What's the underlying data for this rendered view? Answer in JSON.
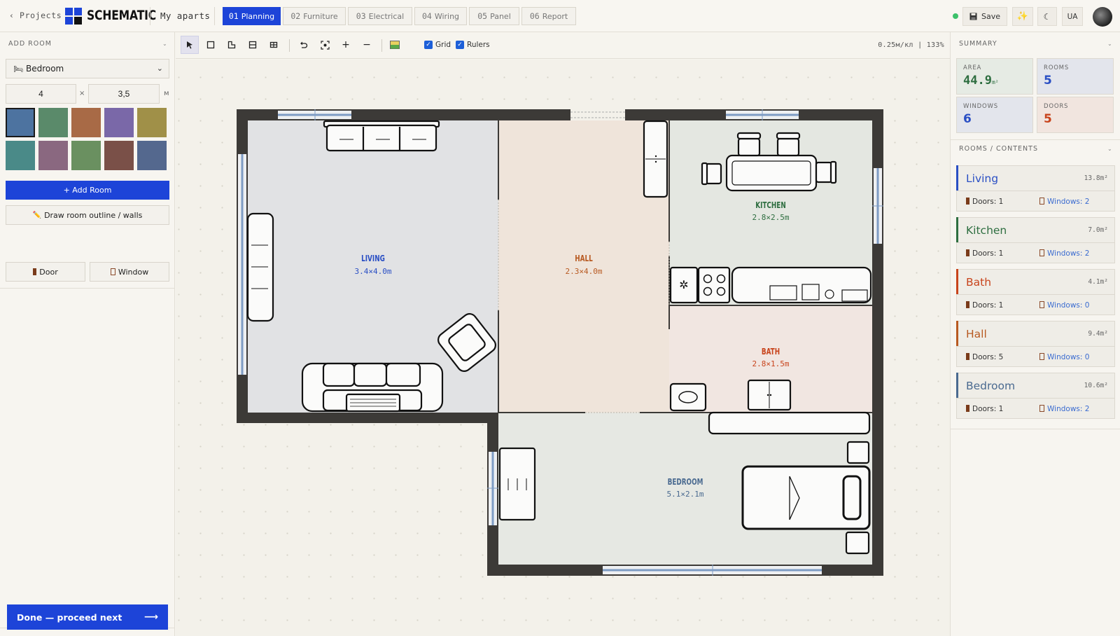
{
  "topbar": {
    "back_label": "‹ Projects",
    "app_name": "SCHEMATIC",
    "project_name": "My aparts",
    "tabs": [
      {
        "num": "01",
        "label": "Planning",
        "active": true
      },
      {
        "num": "02",
        "label": "Furniture",
        "active": false
      },
      {
        "num": "03",
        "label": "Electrical",
        "active": false
      },
      {
        "num": "04",
        "label": "Wiring",
        "active": false
      },
      {
        "num": "05",
        "label": "Panel",
        "active": false
      },
      {
        "num": "06",
        "label": "Report",
        "active": false
      }
    ],
    "save_label": "Save",
    "lang_label": "UA",
    "status_color": "#3cc16a"
  },
  "left": {
    "add_room_title": "ADD ROOM",
    "room_type": "Bedroom",
    "width_value": "4",
    "times_label": "×",
    "height_value": "3,5",
    "unit_label": "м",
    "swatches": [
      "#4d73a0",
      "#5a8a6a",
      "#a86a46",
      "#7a68a8",
      "#a09048",
      "#4a8a88",
      "#8a6880",
      "#6a9060",
      "#7a5048",
      "#54688e"
    ],
    "add_room_label": "+ Add Room",
    "draw_outline_label": "Draw room outline / walls",
    "door_label": "Door",
    "window_label": "Window",
    "done_label": "Done — proceed next",
    "done_arrow": "⟶"
  },
  "toolbar": {
    "grid_label": "Grid",
    "rulers_label": "Rulers",
    "grid_checked": true,
    "rulers_checked": true,
    "scale_readout": "0.25м/кл  |  133%"
  },
  "plan": {
    "rooms": [
      {
        "name": "LIVING",
        "dims": "3.4×4.0m",
        "color": "#2a4fc4"
      },
      {
        "name": "HALL",
        "dims": "2.3×4.0m",
        "color": "#b85a22"
      },
      {
        "name": "KITCHEN",
        "dims": "2.8×2.5m",
        "color": "#2e6e40"
      },
      {
        "name": "BATH",
        "dims": "2.8×1.5m",
        "color": "#c8441c"
      },
      {
        "name": "BEDROOM",
        "dims": "5.1×2.1m",
        "color": "#4a6a90"
      }
    ]
  },
  "summary": {
    "title": "SUMMARY",
    "area_label": "AREA",
    "area_value": "44.9",
    "area_unit": "m²",
    "rooms_label": "ROOMS",
    "rooms_value": "5",
    "windows_label": "WINDOWS",
    "windows_value": "6",
    "doors_label": "DOORS",
    "doors_value": "5"
  },
  "rooms_list": {
    "title": "ROOMS / CONTENTS",
    "items": [
      {
        "name": "Living",
        "area": "13.8m²",
        "doors": "Doors: 1",
        "windows": "Windows: 2",
        "color": "#2a4fc4"
      },
      {
        "name": "Kitchen",
        "area": "7.0m²",
        "doors": "Doors: 1",
        "windows": "Windows: 2",
        "color": "#2e6e40"
      },
      {
        "name": "Bath",
        "area": "4.1m²",
        "doors": "Doors: 1",
        "windows": "Windows: 0",
        "color": "#c8441c"
      },
      {
        "name": "Hall",
        "area": "9.4m²",
        "doors": "Doors: 5",
        "windows": "Windows: 0",
        "color": "#b85a22"
      },
      {
        "name": "Bedroom",
        "area": "10.6m²",
        "doors": "Doors: 1",
        "windows": "Windows: 2",
        "color": "#4a6a90"
      }
    ]
  }
}
